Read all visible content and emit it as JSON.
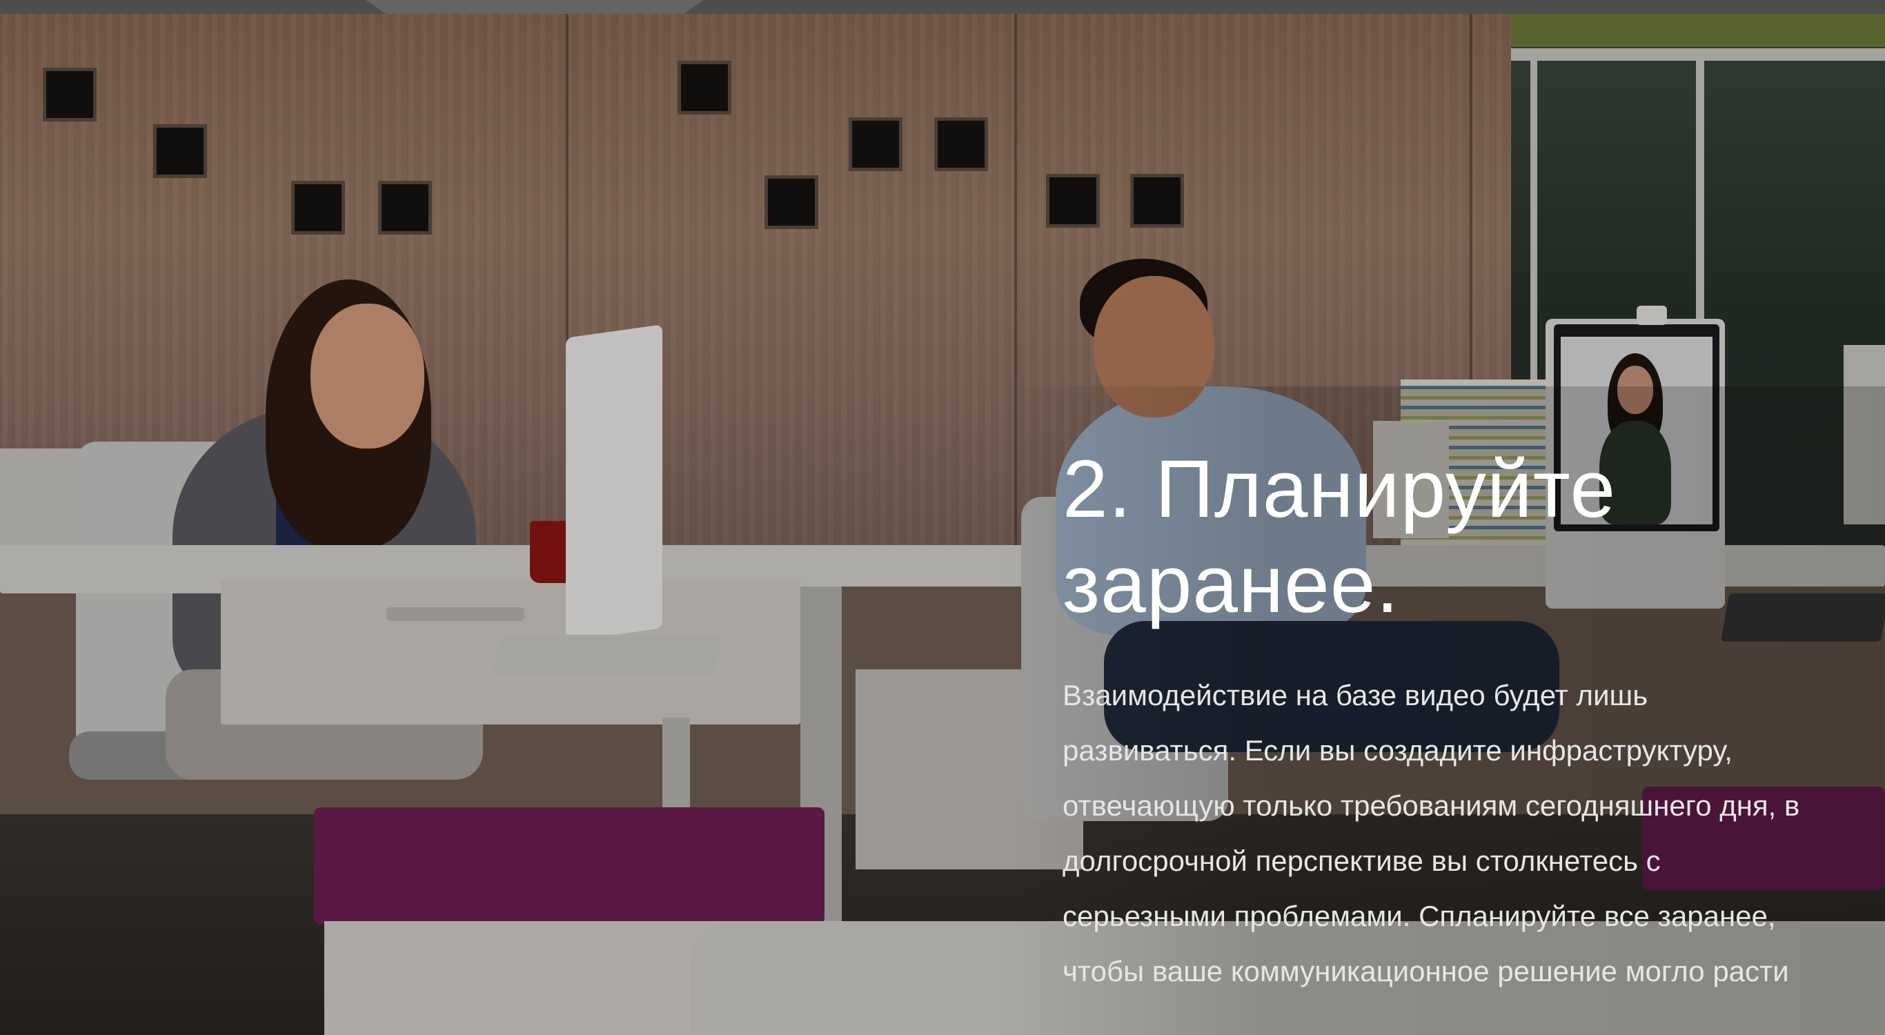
{
  "slide": {
    "heading": "2. Планируйте заранее.",
    "body": "Взаимодействие на базе видео будет лишь развиваться. Если вы создадите инфраструктуру, отвечающую только требованиям сегодняшнего дня, в долгосрочной перспективе вы столкнетесь с серьезными проблемами. Спланируйте все заранее, чтобы ваше коммуникационное решение могло расти"
  },
  "colors": {
    "text_primary": "#ffffff",
    "text_secondary": "#e6e6e6",
    "cushion_accent": "#6e1f55"
  }
}
